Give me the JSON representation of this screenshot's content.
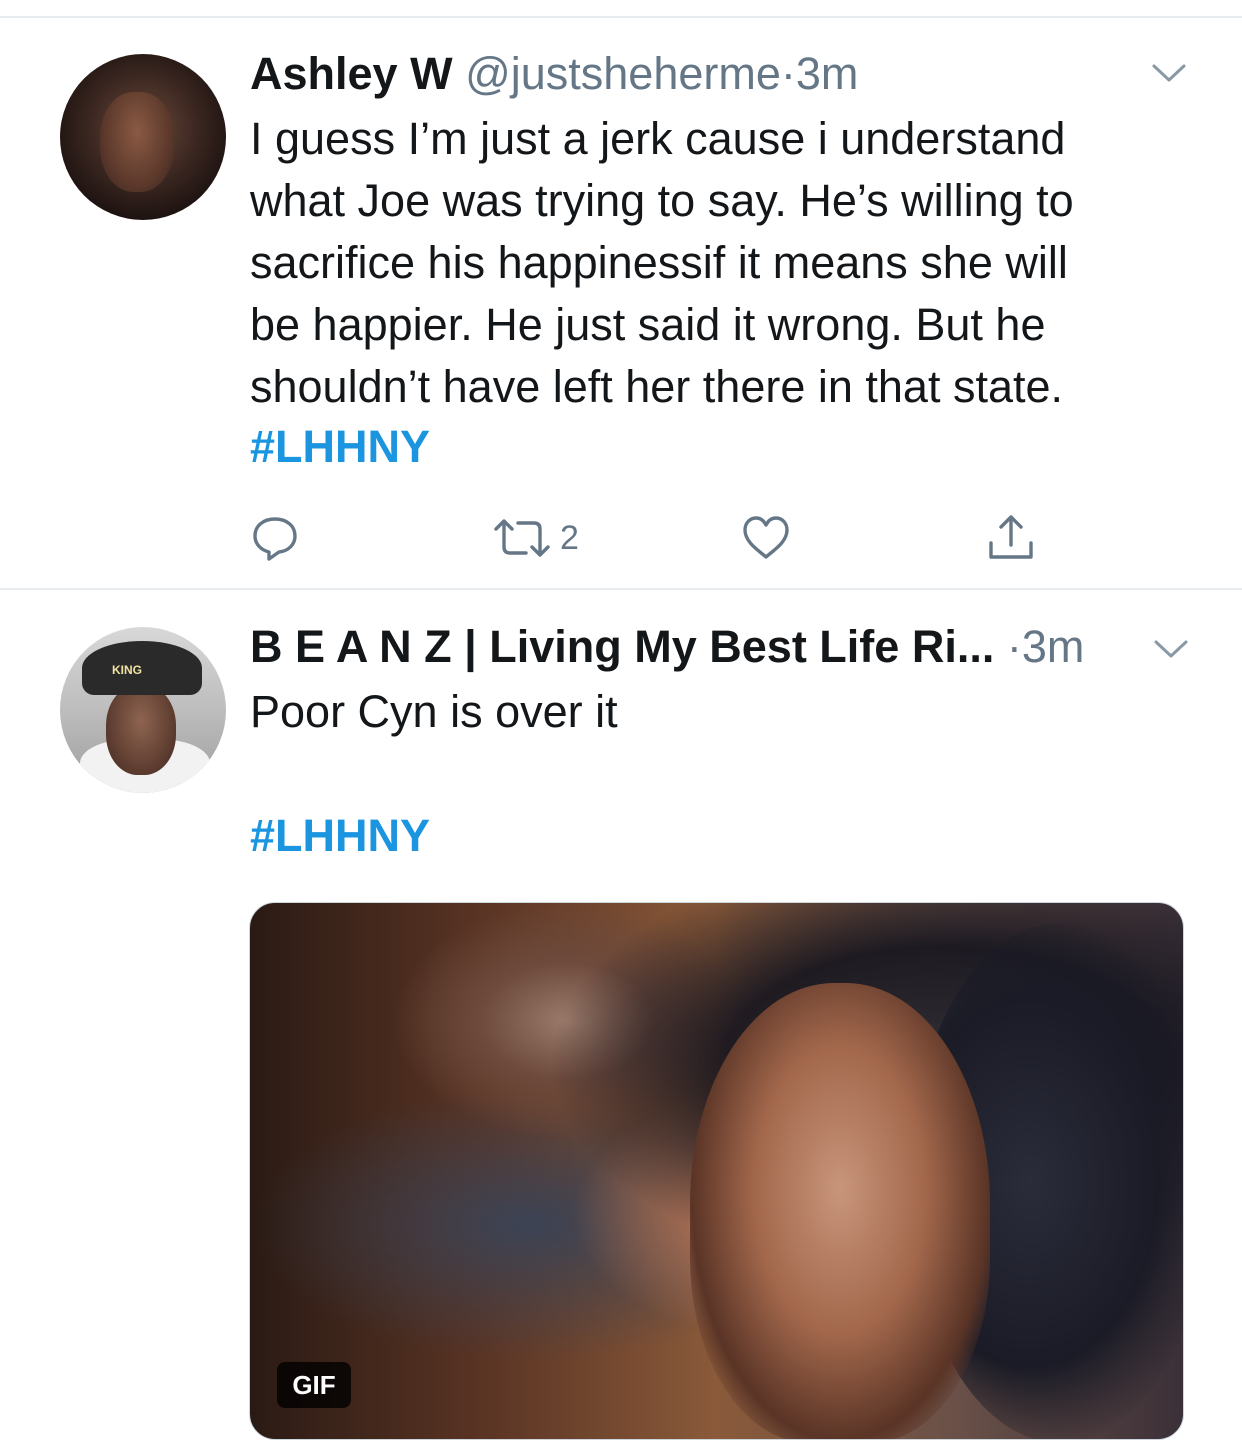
{
  "tweets": [
    {
      "display_name": "Ashley W",
      "handle": "@justsheherme",
      "separator": "·",
      "time": "3m",
      "text": "I guess I’m just a jerk cause i understand\nwhat Joe was trying to say. He’s willing to\nsacrifice his happinessif it means she will\nbe happier. He just said it wrong. But he\nshouldn’t have left her there in that state.",
      "hashtag": "#LHHNY",
      "retweet_count": "2"
    },
    {
      "display_name": "B E A N Z | Living My Best Life Ri...",
      "separator": "·",
      "time": "3m",
      "text": "Poor Cyn is over it",
      "hashtag": "#LHHNY",
      "media_badge": "GIF",
      "avatar_cap_text": "KING"
    }
  ],
  "icons": {
    "reply": "reply-icon",
    "retweet": "retweet-icon",
    "like": "heart-icon",
    "share": "share-icon",
    "more": "chevron-down-icon"
  },
  "colors": {
    "text": "#14171a",
    "muted": "#657786",
    "link": "#1b95e0",
    "divider": "#e6ecf0"
  }
}
